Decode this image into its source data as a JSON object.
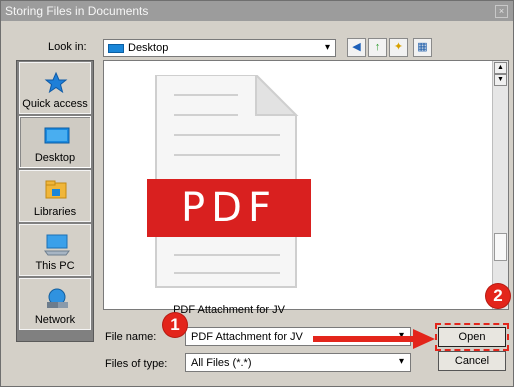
{
  "window": {
    "title": "Storing Files in Documents",
    "close_glyph": "×"
  },
  "lookin": {
    "label": "Look in:",
    "value": "Desktop"
  },
  "toolbar": {
    "back": "◀",
    "up": "↑",
    "newfolder": "✦",
    "views": "▦"
  },
  "places": [
    {
      "label": "Quick access",
      "icon": "star-icon"
    },
    {
      "label": "Desktop",
      "icon": "desktop-icon"
    },
    {
      "label": "Libraries",
      "icon": "libraries-icon"
    },
    {
      "label": "This PC",
      "icon": "computer-icon"
    },
    {
      "label": "Network",
      "icon": "network-icon"
    }
  ],
  "file": {
    "name": "PDF Attachment for JV",
    "badge_text": "PDF"
  },
  "filename": {
    "label": "File name:",
    "value": "PDF Attachment for JV"
  },
  "filetype": {
    "label": "Files of type:",
    "value": "All Files (*.*)"
  },
  "buttons": {
    "open": "Open",
    "cancel": "Cancel"
  },
  "annotations": {
    "step1": "1",
    "step2": "2"
  },
  "colors": {
    "accent_red": "#e3251b",
    "titlebar": "#9c9c9c",
    "dialog_bg": "#d4d0c8"
  }
}
